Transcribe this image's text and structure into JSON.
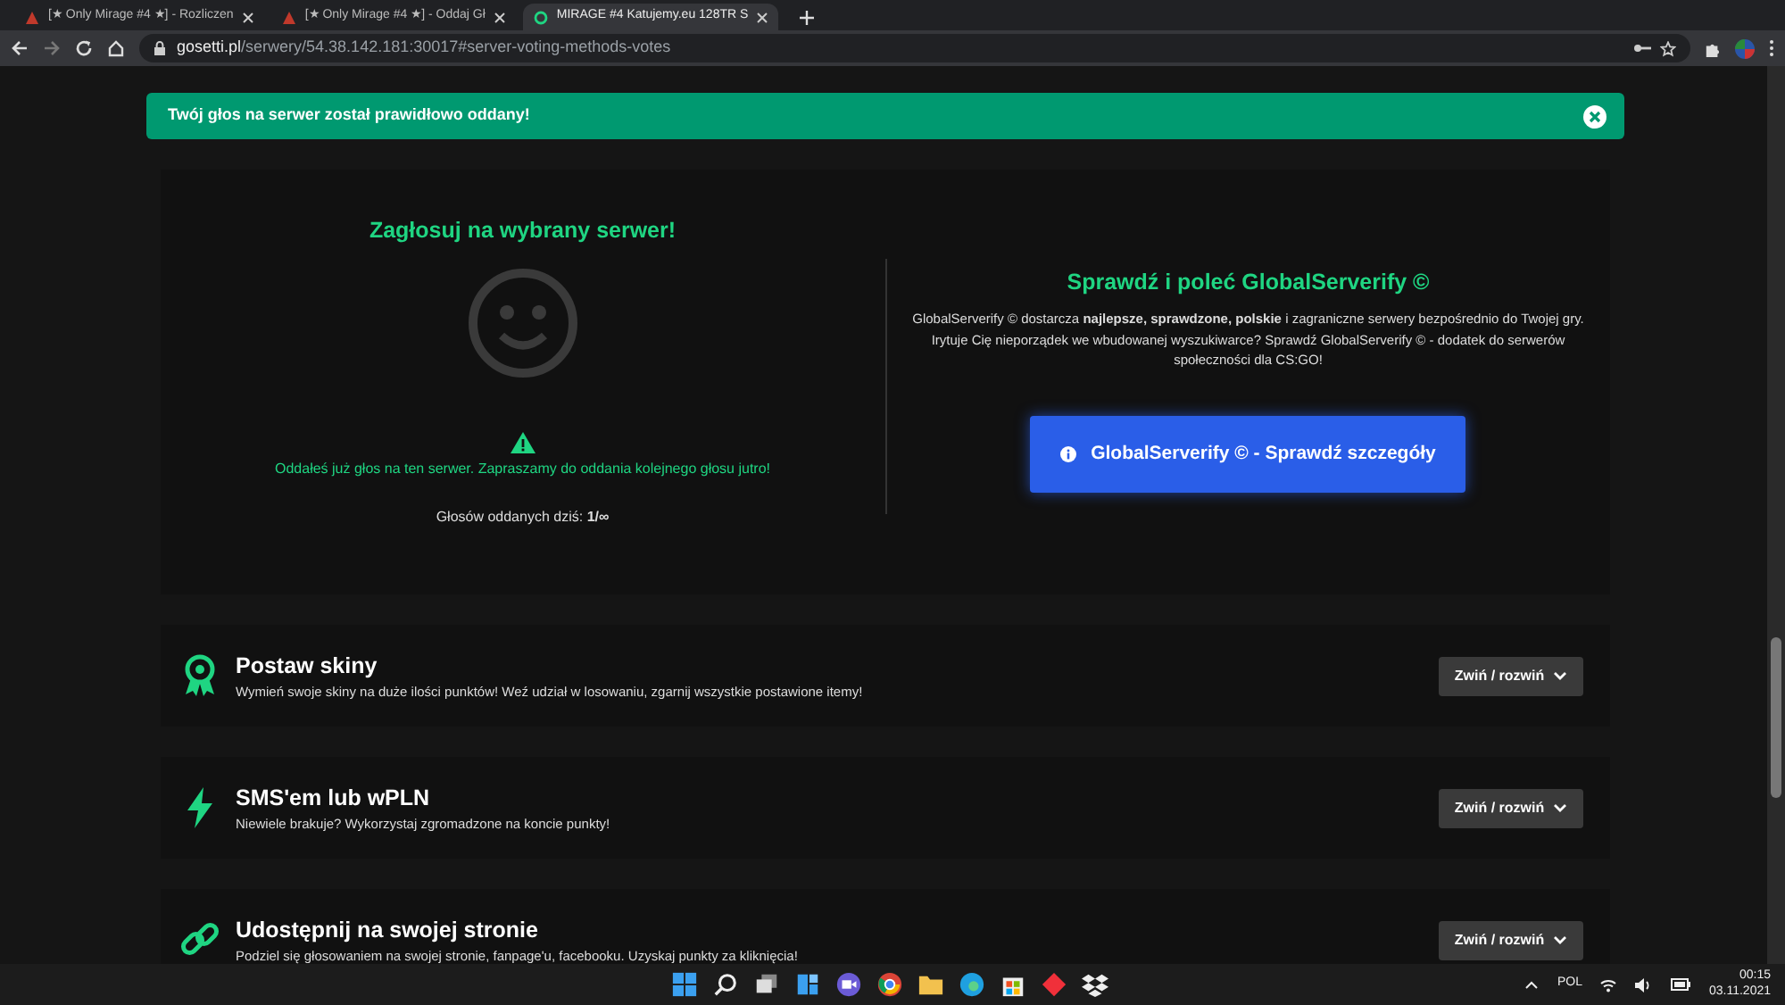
{
  "browser": {
    "tabs": [
      {
        "title": "[★ Only Mirage #4 ★] - Rozliczen",
        "selected": false
      },
      {
        "title": "[★ Only Mirage #4 ★] - Oddaj Gł",
        "selected": false
      },
      {
        "title": "MIRAGE #4 Katujemy.eu 128TR S",
        "selected": true
      }
    ],
    "address": {
      "domain": "gosetti.pl",
      "path": "/serwery/54.38.142.181:30017#server-voting-methods-votes"
    }
  },
  "alert": {
    "message": "Twój głos na serwer został prawidłowo oddany!"
  },
  "vote": {
    "title": "Zagłosuj na wybrany serwer!",
    "notice": "Oddałeś już głos na ten serwer. Zapraszamy do oddania kolejnego głosu jutro!",
    "count": "Głosów oddanych dziś: **1/∞**"
  },
  "promo": {
    "title": "Sprawdź i poleć GlobalServerify ©",
    "text": "GlobalServerify © dostarcza **najlepsze, sprawdzone, polskie** i zagraniczne serwery bezpośrednio do Twojej gry. Irytuje Cię nieporządek we wbudowanej wyszukiwarce? Sprawdź GlobalServerify © - dodatek do serwerów społeczności dla CS:GO!",
    "button": "GlobalServerify © - Sprawdź szczegóły"
  },
  "sections": [
    {
      "kind": "award",
      "title": "Postaw skiny",
      "description": "Wymień swoje skiny na duże ilości punktów! Weź udział w losowaniu, zgarnij wszystkie postawione itemy!",
      "toggle": "Zwiń / rozwiń"
    },
    {
      "kind": "bolt",
      "title": "SMS'em lub wPLN",
      "description": "Niewiele brakuje? Wykorzystaj zgromadzone na koncie punkty!",
      "toggle": "Zwiń / rozwiń"
    },
    {
      "kind": "link",
      "title": "Udostępnij na swojej stronie",
      "description": "Podziel się głosowaniem na swojej stronie, fanpage'u, facebooku. Uzyskaj punkty za kliknięcia!",
      "toggle": "Zwiń / rozwiń"
    }
  ],
  "taskbar": {
    "language": "POL",
    "time": "00:15",
    "date": "03.11.2021"
  }
}
